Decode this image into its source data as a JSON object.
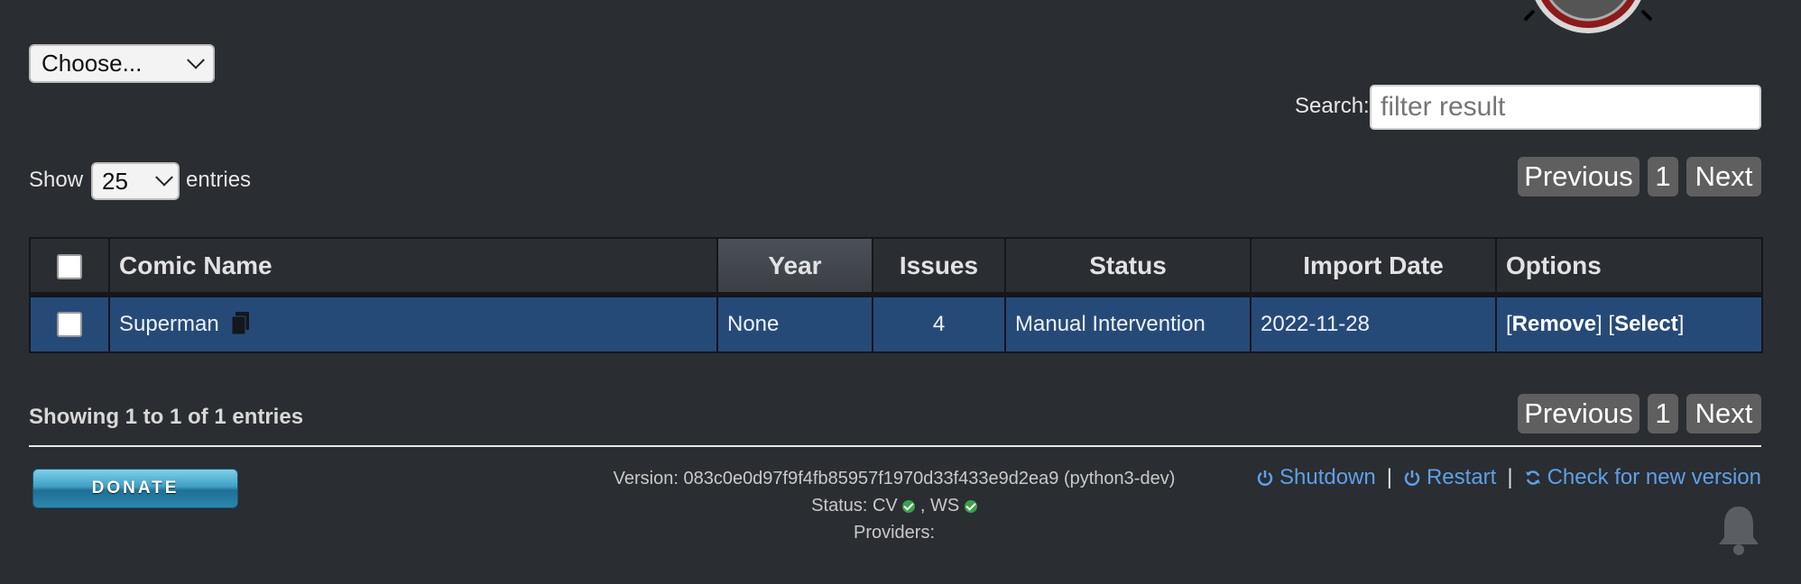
{
  "header": {
    "choose_select": {
      "value": "Choose..."
    }
  },
  "search": {
    "label": "Search:",
    "placeholder": "filter result"
  },
  "length": {
    "show_label": "Show",
    "value": "25",
    "entries_label": "entries"
  },
  "pagination": {
    "previous": "Previous",
    "page": "1",
    "next": "Next"
  },
  "table": {
    "headers": {
      "name": "Comic Name",
      "year": "Year",
      "issues": "Issues",
      "status": "Status",
      "import_date": "Import Date",
      "options": "Options"
    },
    "rows": [
      {
        "name": "Superman",
        "year": "None",
        "issues": "4",
        "status": "Manual Intervention",
        "import_date": "2022-11-28",
        "remove": "Remove",
        "select": "Select"
      }
    ]
  },
  "info": {
    "showing": "Showing 1 to 1 of 1 entries"
  },
  "footer": {
    "donate": "DONATE",
    "version": "Version: 083c0e0d97f9f4fb85957f1970d33f433e9d2ea9 (python3-dev)",
    "status_prefix": "Status: CV",
    "status_ws": ", WS",
    "providers": "Providers:",
    "shutdown": "Shutdown",
    "restart": "Restart",
    "check": "Check for new version"
  },
  "colors": {
    "background": "#2a2d32",
    "row_selected": "#264a78",
    "link": "#5ea0e6",
    "button": "#5f5f5f"
  },
  "icons": [
    "chevron-down-icon",
    "file-copy-icon",
    "check-circle-icon",
    "power-icon",
    "refresh-icon",
    "bell-icon"
  ]
}
